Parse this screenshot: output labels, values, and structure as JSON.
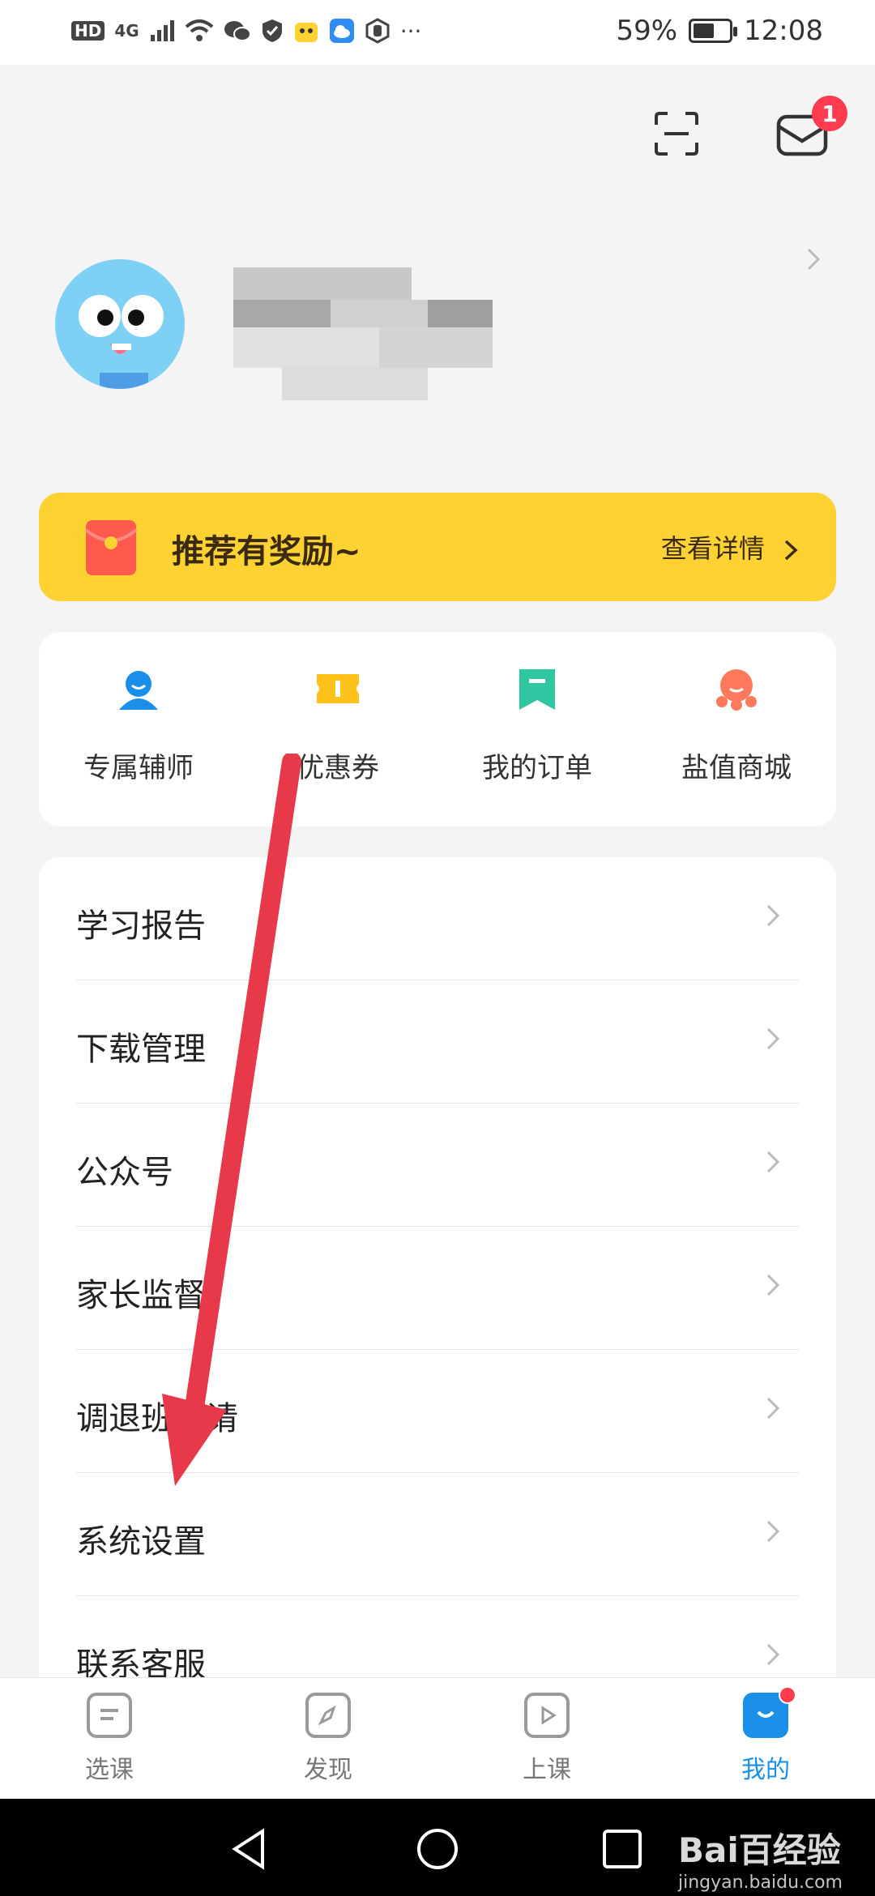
{
  "status_bar": {
    "left_labels": [
      "HD",
      "4G"
    ],
    "more": "···",
    "battery": "59%",
    "battery_level": 0.59,
    "time": "12:08"
  },
  "header": {
    "scan_icon": "scan-icon",
    "mail_icon": "mail-icon",
    "mail_badge": "1"
  },
  "banner": {
    "title": "推荐有奖励~",
    "link": "查看详情"
  },
  "quick_actions": [
    {
      "label": "专属辅师",
      "icon": "tutor-icon",
      "color": "#1a8fe8"
    },
    {
      "label": "优惠券",
      "icon": "coupon-icon",
      "color": "#ffc21a"
    },
    {
      "label": "我的订单",
      "icon": "order-icon",
      "color": "#2ec7a1"
    },
    {
      "label": "盐值商城",
      "icon": "mall-icon",
      "color": "#ff7a5c"
    }
  ],
  "menu": [
    {
      "label": "学习报告"
    },
    {
      "label": "下载管理"
    },
    {
      "label": "公众号"
    },
    {
      "label": "家长监督"
    },
    {
      "label": "调退班申请"
    },
    {
      "label": "系统设置"
    },
    {
      "label": "联系客服"
    }
  ],
  "tabs": [
    {
      "label": "选课",
      "icon": "course-icon"
    },
    {
      "label": "发现",
      "icon": "compass-icon"
    },
    {
      "label": "上课",
      "icon": "play-icon"
    },
    {
      "label": "我的",
      "icon": "profile-face-icon",
      "active": true
    }
  ],
  "colors": {
    "accent": "#1a8fe8",
    "banner": "#ffd233",
    "badge": "#ff3b4e",
    "arrow": "#e8394a"
  },
  "watermark": {
    "brand": "Bai百经验",
    "url": "jingyan.baidu.com"
  }
}
